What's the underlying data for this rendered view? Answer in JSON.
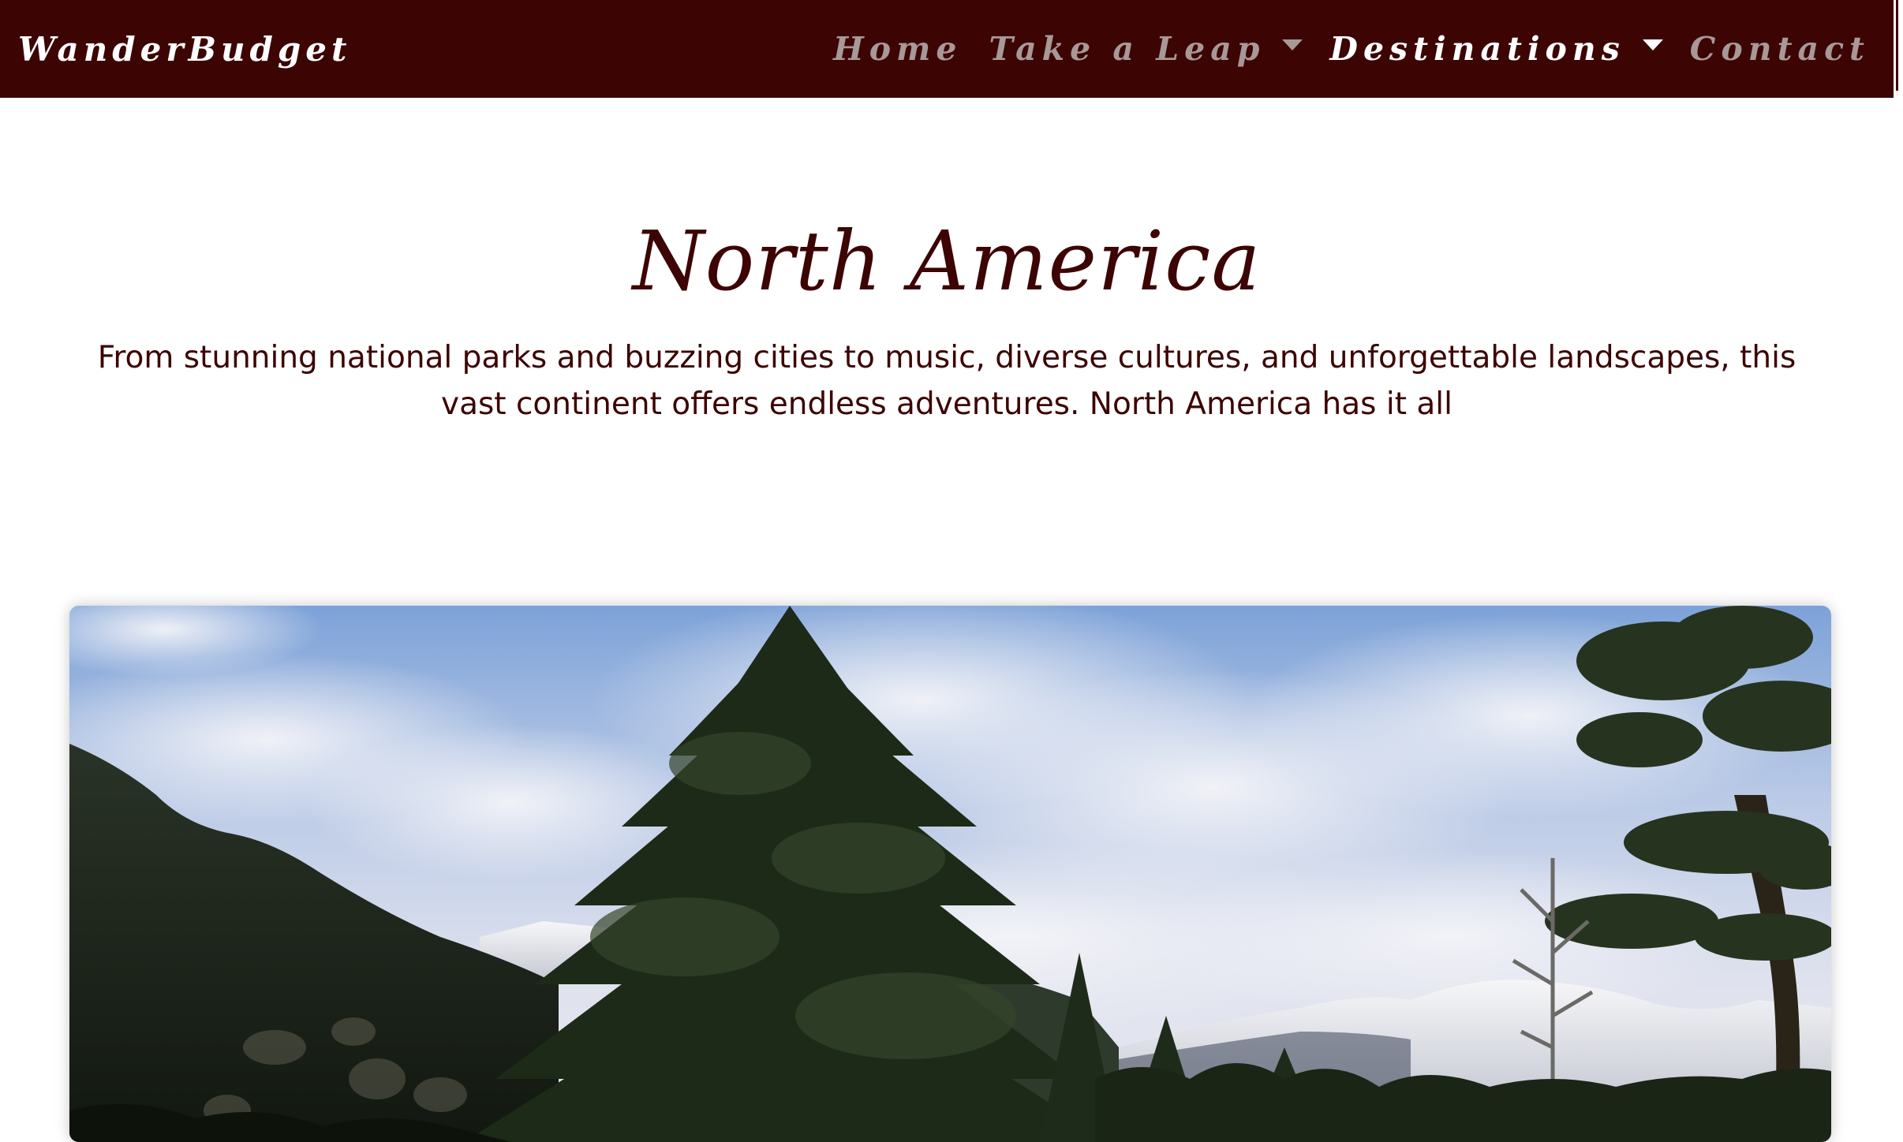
{
  "navbar": {
    "brand": "WanderBudget",
    "links": [
      {
        "label": "Home"
      },
      {
        "label": "Take a Leap"
      },
      {
        "label": "Destinations"
      },
      {
        "label": "Contact"
      }
    ]
  },
  "hero": {
    "title": "North America",
    "description": "From stunning national parks and buzzing cities to music, diverse cultures, and unforgettable landscapes, this vast continent offers endless adventures. North America has it all"
  },
  "photo": {
    "subject": "mountain forest landscape"
  },
  "colors": {
    "brand": "#3d0404",
    "nav_inactive": "#a89898",
    "nav_active": "#ffffff"
  }
}
